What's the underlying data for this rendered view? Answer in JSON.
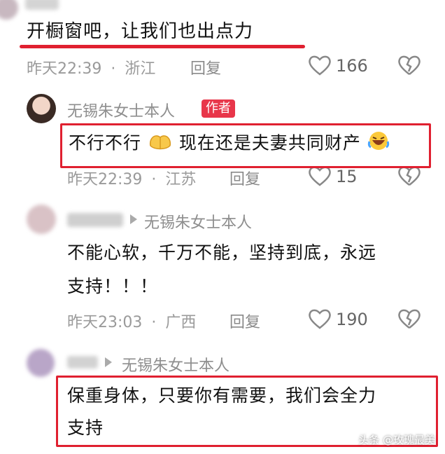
{
  "comment1": {
    "text": "开橱窗吧，让我们也出点力",
    "time": "昨天22:39",
    "location": "浙江",
    "reply_label": "回复",
    "likes": "166"
  },
  "comment2": {
    "author": "无锡朱女士本人",
    "badge": "作者",
    "text_a": "不行不行",
    "text_b": "现在还是夫妻共同财产",
    "time": "昨天22:39",
    "location": "江苏",
    "reply_label": "回复",
    "likes": "15"
  },
  "comment3": {
    "reply_to": "无锡朱女士本人",
    "text_line1": "不能心软，千万不能，坚持到底，永远",
    "text_line2": "支持！！！",
    "time": "昨天23:03",
    "location": "广西",
    "reply_label": "回复",
    "likes": "190"
  },
  "comment4": {
    "reply_to": "无锡朱女士本人",
    "text_line1": "保重身体，只要你有需要，我们会全力",
    "text_line2": "支持"
  },
  "separator": "·",
  "watermark": "头条 @玫瑰最美",
  "colors": {
    "highlight": "#e02030",
    "badge": "#e8364a",
    "meta": "#9a9a9a"
  },
  "icons": [
    "heart-outline-icon",
    "broken-heart-icon",
    "folded-hands-emoji",
    "laughing-emoji",
    "triangle-arrow-icon"
  ]
}
